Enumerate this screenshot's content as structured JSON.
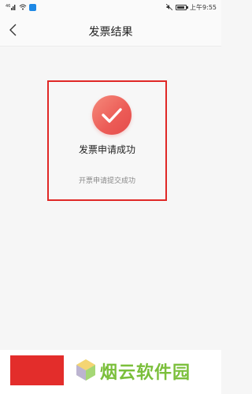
{
  "status_bar": {
    "signal_text": "4G",
    "time": "上午9:55"
  },
  "header": {
    "title": "发票结果"
  },
  "result": {
    "title": "发票申请成功",
    "subtitle": "开票申请提交成功",
    "icon": "check-circle-icon",
    "accent_color": "#ec5b56",
    "highlight_color": "#e02826"
  },
  "bottom": {
    "watermark": "烟云软件园",
    "block_color": "#e32d2b"
  }
}
